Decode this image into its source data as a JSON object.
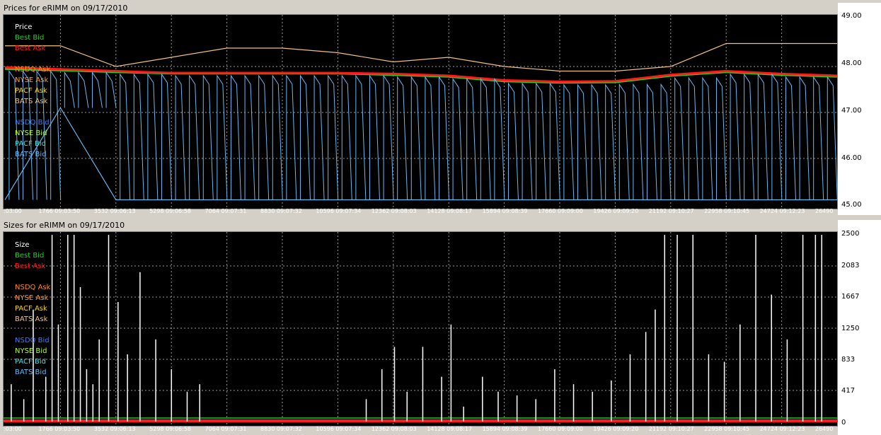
{
  "app": {
    "price_title": "Prices for  eRIMM  on  09/17/2010",
    "size_title": "Sizes for  eRIMM  on  09/17/2010"
  },
  "colors": {
    "best_bid": "#21d321",
    "best_ask": "#ff1a1a",
    "nsdq_ask": "#ff8c1a",
    "nyse_ask": "#ff9933",
    "pacf_ask": "#ffd400",
    "bats_ask": "#f2c080",
    "nsdq_bid": "#3a7dff",
    "nyse_bid": "#b7ff3a",
    "pacf_bid": "#41e0d8",
    "bats_bid": "#6ab8f0"
  },
  "chart_data": [
    {
      "type": "line",
      "title": "Prices for  eRIMM  on  09/17/2010",
      "legend_title": "Price",
      "legend": [
        "Best Bid",
        "Best Ask",
        "",
        "NSDQ Ask",
        "NYSE Ask",
        "PACF Ask",
        "BATS Ask",
        "",
        "NSDQ Bid",
        "NYSE Bid",
        "PACF Bid",
        "BATS Bid"
      ],
      "legend_placement": "top-left",
      "ylim": [
        45.0,
        49.0
      ],
      "yticks": [
        "49.00",
        "48.00",
        "47.00",
        "46.00",
        "45.00"
      ],
      "xticks": [
        ":03:00",
        "1766 09:03:50",
        "3532 09:06:13",
        "5298 09:06:58",
        "7064 09:07:31",
        "8830 09:07:32",
        "10596 09:07:34",
        "12362 09:08:03",
        "14128 09:08:17",
        "15894 09:08:39",
        "17660 09:09:00",
        "19426 09:09:20",
        "21192 09:10:27",
        "22958 09:10:45",
        "24724 09:12:23",
        "26490"
      ],
      "grid": true,
      "series": [
        {
          "name": "Best Bid",
          "x": [
            0,
            1766,
            3532,
            5298,
            7064,
            8830,
            10596,
            12362,
            14128,
            15894,
            17660,
            19426,
            21192,
            22958,
            24724,
            26490
          ],
          "values": [
            47.95,
            47.92,
            47.88,
            47.85,
            47.85,
            47.85,
            47.85,
            47.82,
            47.78,
            47.68,
            47.65,
            47.66,
            47.8,
            47.88,
            47.82,
            47.78
          ]
        },
        {
          "name": "Best Ask",
          "x": [
            0,
            1766,
            3532,
            5298,
            7064,
            8830,
            10596,
            12362,
            14128,
            15894,
            17660,
            19426,
            21192,
            22958,
            24724,
            26490
          ],
          "values": [
            47.98,
            47.94,
            47.9,
            47.86,
            47.86,
            47.86,
            47.86,
            47.84,
            47.8,
            47.7,
            47.67,
            47.68,
            47.82,
            47.9,
            47.84,
            47.8
          ]
        },
        {
          "name": "BATS Ask",
          "x": [
            0,
            1766,
            3532,
            5298,
            7064,
            8830,
            10596,
            12362,
            14128,
            15894,
            17660,
            19426,
            21192,
            22958,
            24724,
            26490
          ],
          "values": [
            48.45,
            48.45,
            48.0,
            48.2,
            48.4,
            48.4,
            48.3,
            48.1,
            48.2,
            48.0,
            47.9,
            47.9,
            48.0,
            48.5,
            48.5,
            48.5
          ]
        },
        {
          "name": "BATS Bid",
          "x": [
            0,
            1766,
            3532,
            5298,
            7064,
            8830,
            10596,
            12362,
            14128,
            15894,
            17660,
            19426,
            21192,
            22958,
            24724,
            26490
          ],
          "values": [
            45.1,
            47.1,
            45.1,
            45.1,
            45.1,
            45.1,
            45.1,
            45.1,
            45.1,
            45.1,
            45.1,
            45.1,
            45.1,
            45.1,
            45.1,
            45.1
          ]
        }
      ]
    },
    {
      "type": "bar",
      "title": "Sizes for  eRIMM  on  09/17/2010",
      "legend_title": "Size",
      "legend": [
        "Best Bid",
        "Best Ask",
        "",
        "NSDQ Ask",
        "NYSE Ask",
        "PACF Ask",
        "BATS Ask",
        "",
        "NSDQ Bid",
        "NYSE Bid",
        "PACF Bid",
        "BATS Bid"
      ],
      "legend_placement": "top-left",
      "ylim": [
        0,
        2500
      ],
      "yticks": [
        "2500",
        "2083",
        "1667",
        "1250",
        "833",
        "417",
        "0"
      ],
      "xticks": [
        ":03:00",
        "1766 09:03:50",
        "3532 09:06:13",
        "5298 09:06:58",
        "7064 09:07:31",
        "8830 09:07:32",
        "10596 09:07:34",
        "12362 09:08:03",
        "14128 09:08:17",
        "15894 09:08:39",
        "17660 09:09:00",
        "19426 09:09:20",
        "21192 09:10:27",
        "22958 09:10:45",
        "24724 09:12:23",
        "26490"
      ],
      "grid": true,
      "series": [
        {
          "name": "Size spikes",
          "x": [
            200,
            600,
            900,
            1300,
            1500,
            1700,
            2000,
            2200,
            2400,
            2600,
            2800,
            3000,
            3300,
            3600,
            3900,
            4300,
            4800,
            5300,
            5800,
            6200,
            11500,
            12000,
            12400,
            12800,
            13300,
            13900,
            14200,
            14600,
            15200,
            15700,
            16300,
            16900,
            17500,
            18100,
            18700,
            19300,
            19900,
            20400,
            20700,
            21000,
            21400,
            21900,
            22400,
            22900,
            23400,
            23900,
            24400,
            24900,
            25400,
            25800,
            26000
          ],
          "values": [
            500,
            300,
            1500,
            600,
            2500,
            1300,
            2500,
            2500,
            1800,
            700,
            500,
            1100,
            2500,
            1600,
            900,
            2000,
            1100,
            700,
            400,
            500,
            300,
            700,
            1000,
            400,
            1000,
            600,
            1300,
            200,
            600,
            400,
            350,
            300,
            700,
            500,
            400,
            550,
            900,
            1200,
            1500,
            2500,
            2500,
            2500,
            900,
            800,
            1300,
            2500,
            1700,
            1100,
            2500,
            2500,
            2500
          ]
        }
      ]
    }
  ]
}
